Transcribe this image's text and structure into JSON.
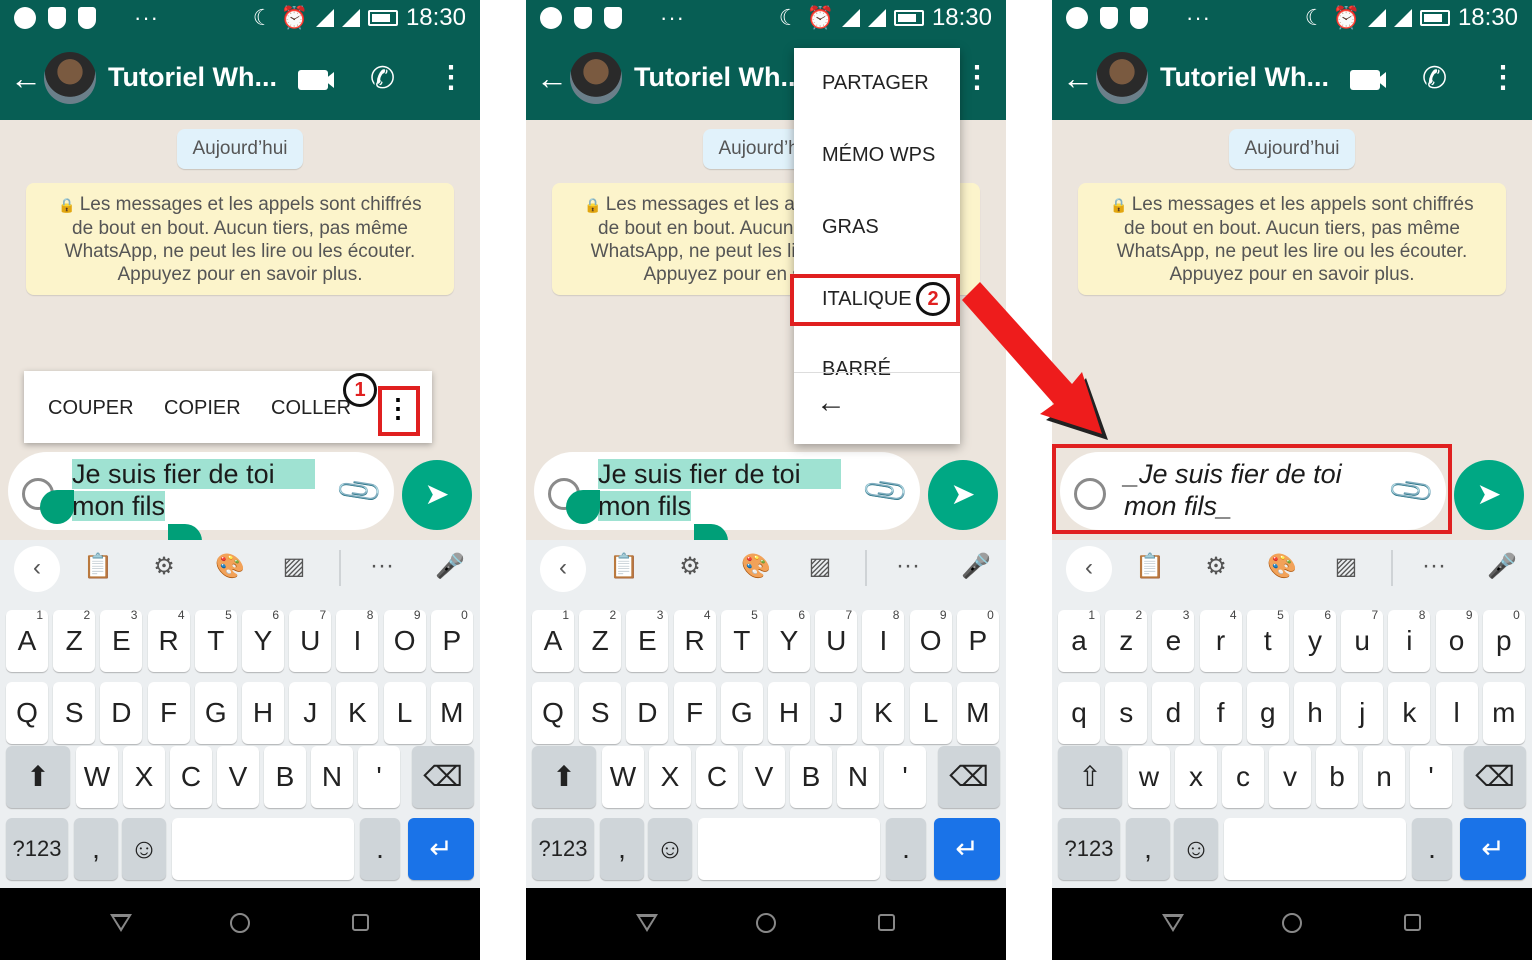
{
  "status": {
    "time": "18:30"
  },
  "chat": {
    "title": "Tutoriel Wh...",
    "day_chip": "Aujourd’hui",
    "notice_lines": [
      "Les messages et les appels sont chiffrés",
      "de bout en bout. Aucun tiers, pas même",
      "WhatsApp, ne peut les lire ou les écouter.",
      "Appuyez pour en savoir plus."
    ]
  },
  "selection_toolbar": {
    "items": [
      "COUPER",
      "COPIER",
      "COLLER"
    ],
    "overflow_icon": "more-vert-icon"
  },
  "annotations": {
    "step1": "1",
    "step2": "2",
    "highlight_color": "#e02020"
  },
  "overflow_menu": {
    "items": [
      "PARTAGER",
      "MÉMO WPS",
      "GRAS",
      "ITALIQUE",
      "BARRÉ"
    ]
  },
  "compose": {
    "selected_line1": "Je suis fier de toi",
    "selected_line2": "mon fils",
    "result_line1": "_Je suis fier de toi",
    "result_line2": "mon fils_"
  },
  "keyboard": {
    "row1_upper": [
      "A",
      "Z",
      "E",
      "R",
      "T",
      "Y",
      "U",
      "I",
      "O",
      "P"
    ],
    "row1_lower": [
      "a",
      "z",
      "e",
      "r",
      "t",
      "y",
      "u",
      "i",
      "o",
      "p"
    ],
    "row1_hints": [
      "1",
      "2",
      "3",
      "4",
      "5",
      "6",
      "7",
      "8",
      "9",
      "0"
    ],
    "row2_upper": [
      "Q",
      "S",
      "D",
      "F",
      "G",
      "H",
      "J",
      "K",
      "L",
      "M"
    ],
    "row2_lower": [
      "q",
      "s",
      "d",
      "f",
      "g",
      "h",
      "j",
      "k",
      "l",
      "m"
    ],
    "row3_upper": [
      "W",
      "X",
      "C",
      "V",
      "B",
      "N",
      "'"
    ],
    "row3_lower": [
      "w",
      "x",
      "c",
      "v",
      "b",
      "n",
      "'"
    ],
    "sym_label": "?123",
    "comma": ",",
    "period": "."
  },
  "colors": {
    "header": "#075e54",
    "accent": "#00a884",
    "enter": "#1a73e8"
  }
}
